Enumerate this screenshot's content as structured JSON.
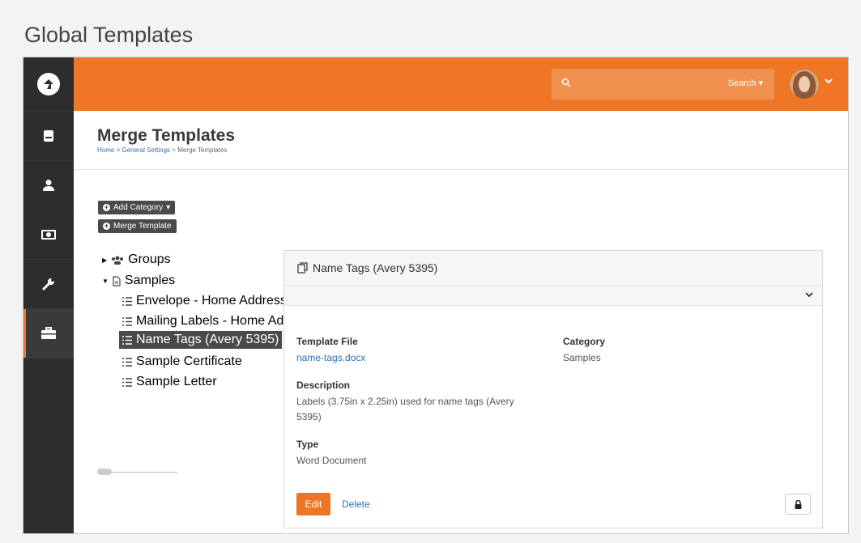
{
  "page": {
    "title": "Global Templates"
  },
  "topbar": {
    "search_label": "Search",
    "search_placeholder": ""
  },
  "header": {
    "title": "Merge Templates",
    "breadcrumb": [
      "Home",
      "General Settings",
      "Merge Templates"
    ]
  },
  "left": {
    "add_category_label": "Add Category",
    "merge_template_label": "Merge Template",
    "tree": [
      {
        "label": "Groups",
        "level": 0,
        "expanded": false,
        "icon": "users-icon"
      },
      {
        "label": "Samples",
        "level": 0,
        "expanded": true,
        "icon": "file-icon"
      },
      {
        "label": "Envelope - Home Address",
        "level": 1,
        "icon": "list-icon"
      },
      {
        "label": "Mailing Labels - Home Adc",
        "level": 1,
        "icon": "list-icon"
      },
      {
        "label": "Name Tags (Avery 5395)",
        "level": 1,
        "icon": "list-icon",
        "selected": true
      },
      {
        "label": "Sample Certificate",
        "level": 1,
        "icon": "list-icon"
      },
      {
        "label": "Sample Letter",
        "level": 1,
        "icon": "list-icon"
      }
    ]
  },
  "panel": {
    "title": "Name Tags (Avery 5395)",
    "template_file_label": "Template File",
    "template_file_value": "name-tags.docx",
    "category_label": "Category",
    "category_value": "Samples",
    "description_label": "Description",
    "description_line1": "Labels (3.75in x 2.25in) used for name tags (Avery",
    "description_line2": "5395)",
    "type_label": "Type",
    "type_value": "Word Document",
    "edit_label": "Edit",
    "delete_label": "Delete"
  },
  "colors": {
    "accent": "#ee7625",
    "sidebar": "#2d2d2d",
    "link": "#2a72b5"
  }
}
